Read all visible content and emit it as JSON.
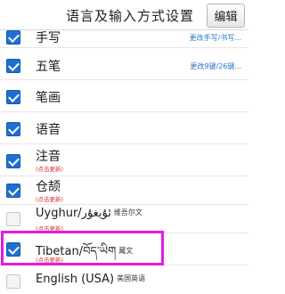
{
  "header": {
    "title": "语言及输入方式设置",
    "edit_label": "编辑"
  },
  "rows": [
    {
      "label": "手写",
      "checked": true,
      "note": "更改手写/书写...",
      "sub": ""
    },
    {
      "label": "五笔",
      "checked": true,
      "note": "更改9键/26键...",
      "sub": ""
    },
    {
      "label": "笔画",
      "checked": true,
      "note": "",
      "sub": ""
    },
    {
      "label": "语音",
      "checked": true,
      "note": "",
      "sub": ""
    },
    {
      "label": "注音",
      "checked": true,
      "note": "",
      "sub": "(点击更新)"
    },
    {
      "label": "仓颉",
      "checked": true,
      "note": "",
      "sub": "(点击更新)"
    },
    {
      "label": "Uyghur/ئۇيغۇر",
      "label_cn": "维吾尔文",
      "checked": false,
      "note": "",
      "sub": "(点击更新)"
    },
    {
      "label": "Tibetan/བོད་ཡིག",
      "label_cn": "藏文",
      "checked": true,
      "note": "",
      "sub": "(点击更新)"
    },
    {
      "label": "English (USA)",
      "label_cn": "美国英语",
      "checked": false,
      "note": "",
      "sub": ""
    }
  ],
  "colors": {
    "checkbox": "#1f6fd1",
    "highlight": "#e21ce0",
    "sub_text": "#d9302a",
    "note_text": "#2b74c8"
  }
}
